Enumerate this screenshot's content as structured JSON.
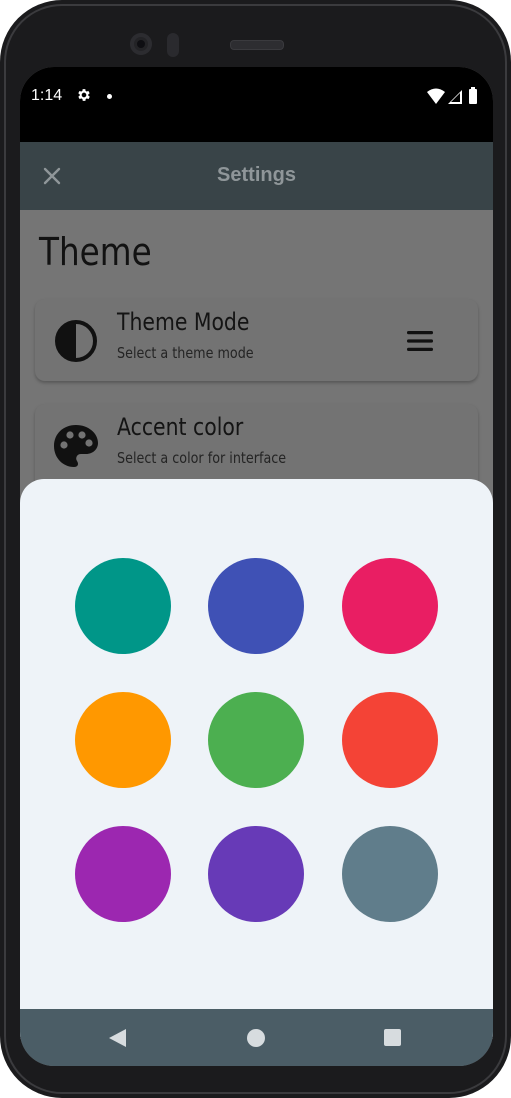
{
  "status_bar": {
    "time": "1:14",
    "icons": [
      "gear-icon",
      "notification-dot-icon",
      "wifi-icon",
      "signal-icon",
      "battery-icon"
    ]
  },
  "app_bar": {
    "title": "Settings",
    "close_icon": "close-icon"
  },
  "section": {
    "title": "Theme"
  },
  "settings": [
    {
      "title": "Theme Mode",
      "subtitle": "Select a theme mode",
      "icon": "contrast-icon",
      "trailing_icon": "menu-icon"
    },
    {
      "title": "Accent color",
      "subtitle": "Select a color for interface",
      "icon": "palette-icon"
    }
  ],
  "color_picker": {
    "swatches": [
      {
        "name": "teal",
        "color": "#009688"
      },
      {
        "name": "indigo",
        "color": "#3F51B5"
      },
      {
        "name": "pink",
        "color": "#E91E63"
      },
      {
        "name": "orange",
        "color": "#FF9800"
      },
      {
        "name": "green",
        "color": "#4CAF50"
      },
      {
        "name": "red",
        "color": "#F44336"
      },
      {
        "name": "purple",
        "color": "#9C27B0"
      },
      {
        "name": "deep-purple",
        "color": "#673AB7"
      },
      {
        "name": "blue-grey",
        "color": "#607D8B"
      }
    ]
  },
  "nav_bar": {
    "buttons": [
      "back-icon",
      "home-icon",
      "recents-icon"
    ]
  },
  "colors": {
    "app_bar": "#394448",
    "scrim": "#757575",
    "sheet": "#EEF3F8",
    "nav_bar": "#4B5D66"
  }
}
